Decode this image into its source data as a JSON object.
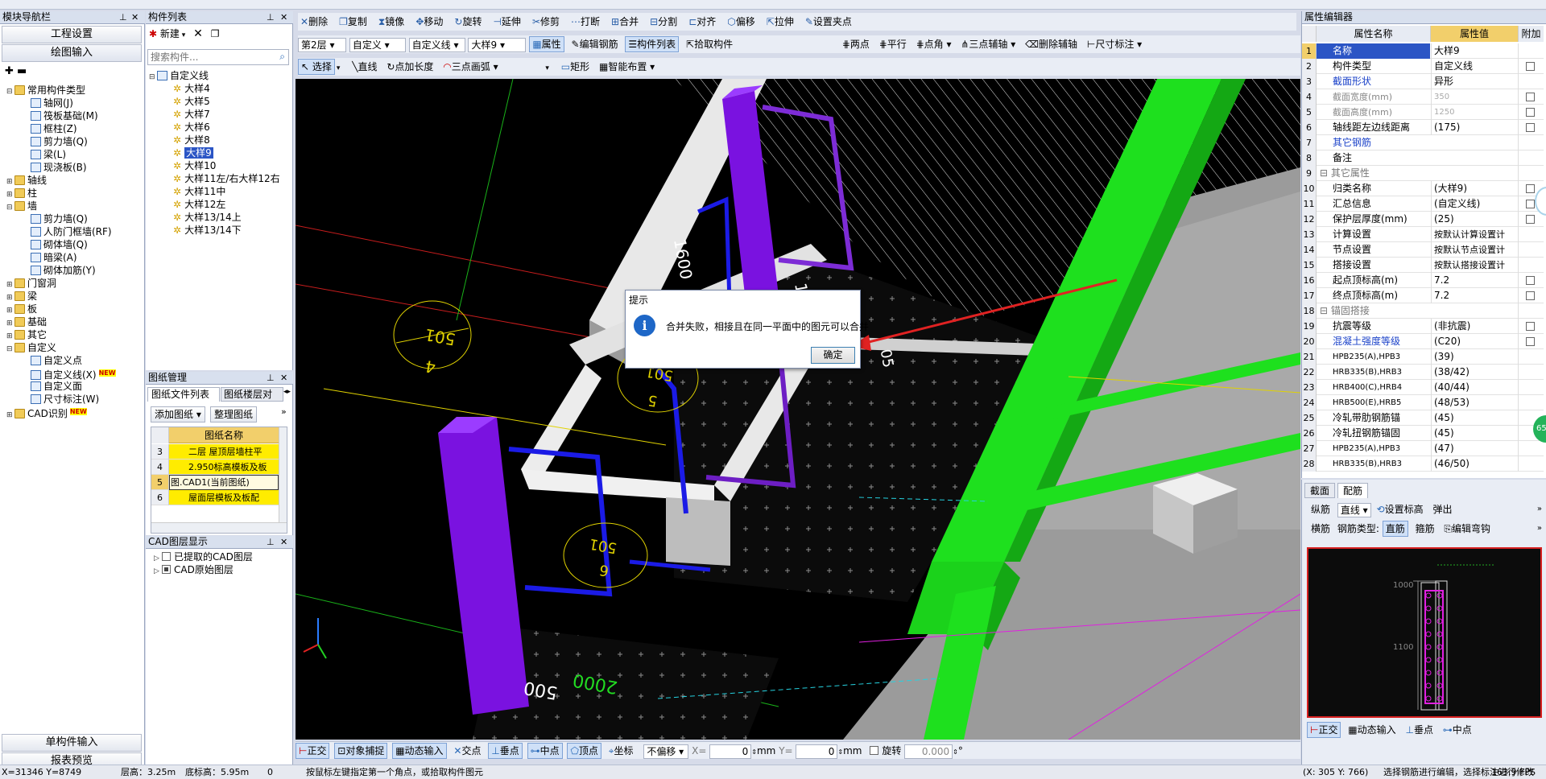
{
  "top_toolbar": [
    "删除",
    "复制",
    "镜像",
    "移动",
    "旋转",
    "延伸",
    "修剪",
    "打断",
    "合并",
    "分割",
    "对齐",
    "偏移",
    "拉伸",
    "设置夹点"
  ],
  "nav": {
    "title": "模块导航栏",
    "btn_project": "工程设置",
    "btn_draw": "绘图输入",
    "tree": [
      {
        "label": "常用构件类型",
        "lvl": 0,
        "type": "folder",
        "tog": "▬"
      },
      {
        "label": "轴网(J)",
        "lvl": 1
      },
      {
        "label": "筏板基础(M)",
        "lvl": 1
      },
      {
        "label": "框柱(Z)",
        "lvl": 1
      },
      {
        "label": "剪力墙(Q)",
        "lvl": 1
      },
      {
        "label": "梁(L)",
        "lvl": 1
      },
      {
        "label": "现浇板(B)",
        "lvl": 1
      },
      {
        "label": "轴线",
        "lvl": 0,
        "type": "folder",
        "tog": "+"
      },
      {
        "label": "柱",
        "lvl": 0,
        "type": "folder",
        "tog": "+"
      },
      {
        "label": "墙",
        "lvl": 0,
        "type": "folder",
        "tog": "▬"
      },
      {
        "label": "剪力墙(Q)",
        "lvl": 1
      },
      {
        "label": "人防门框墙(RF)",
        "lvl": 1
      },
      {
        "label": "砌体墙(Q)",
        "lvl": 1
      },
      {
        "label": "暗梁(A)",
        "lvl": 1
      },
      {
        "label": "砌体加筋(Y)",
        "lvl": 1
      },
      {
        "label": "门窗洞",
        "lvl": 0,
        "type": "folder",
        "tog": "+"
      },
      {
        "label": "梁",
        "lvl": 0,
        "type": "folder",
        "tog": "+"
      },
      {
        "label": "板",
        "lvl": 0,
        "type": "folder",
        "tog": "+"
      },
      {
        "label": "基础",
        "lvl": 0,
        "type": "folder",
        "tog": "+"
      },
      {
        "label": "其它",
        "lvl": 0,
        "type": "folder",
        "tog": "+"
      },
      {
        "label": "自定义",
        "lvl": 0,
        "type": "folder",
        "tog": "▬"
      },
      {
        "label": "自定义点",
        "lvl": 1
      },
      {
        "label": "自定义线(X)",
        "lvl": 1,
        "badge": "NEW"
      },
      {
        "label": "自定义面",
        "lvl": 1
      },
      {
        "label": "尺寸标注(W)",
        "lvl": 1
      },
      {
        "label": "CAD识别",
        "lvl": 0,
        "type": "folder",
        "tog": "+",
        "badge": "NEW"
      }
    ],
    "btn_single": "单构件输入",
    "btn_report": "报表预览"
  },
  "comp": {
    "title": "构件列表",
    "new_label": "新建",
    "search_placeholder": "搜索构件...",
    "root": "自定义线",
    "items": [
      "大样4",
      "大样5",
      "大样7",
      "大样6",
      "大样8",
      "大样9",
      "大样10",
      "大样11左/右大样12右",
      "大样11中",
      "大样12左",
      "大样13/14上",
      "大样13/14下"
    ],
    "selected_index": 5
  },
  "drawing": {
    "title": "图纸管理",
    "tab1": "图纸文件列表",
    "tab2": "图纸楼层对",
    "btn_add": "添加图纸",
    "btn_organize": "整理图纸",
    "col_header": "图纸名称",
    "rows": [
      {
        "n": "3",
        "name": "二层 屋顶层墙柱平"
      },
      {
        "n": "4",
        "name": "2.950标高模板及板"
      },
      {
        "n": "5",
        "name": "图.CAD1(当前图纸)"
      },
      {
        "n": "6",
        "name": "屋面层模板及板配"
      }
    ]
  },
  "cad_layers": {
    "title": "CAD图层显示",
    "items": [
      "已提取的CAD图层",
      "CAD原始图层"
    ]
  },
  "toolbar2": {
    "floor": "第2层",
    "type": "自定义",
    "subtype": "自定义线",
    "item": "大样9",
    "buttons": [
      "属性",
      "编辑钢筋",
      "构件列表",
      "拾取构件"
    ],
    "right_buttons": [
      "两点",
      "平行",
      "点角",
      "三点辅轴",
      "删除辅轴",
      "尺寸标注"
    ]
  },
  "toolbar3": {
    "buttons": [
      "选择",
      "直线",
      "点加长度",
      "三点画弧",
      "矩形",
      "智能布置"
    ]
  },
  "viewport": {
    "labels": [
      "1600",
      "1600",
      "501",
      "4",
      "501",
      "5",
      "501",
      "6",
      "500",
      "2000",
      "05"
    ]
  },
  "dialog": {
    "title": "提示",
    "message": "合并失败，相接且在同一平面中的图元可以合并",
    "ok_label": "确定"
  },
  "bottom_bar": {
    "buttons": [
      "正交",
      "对象捕捉",
      "动态输入",
      "交点",
      "垂点",
      "中点",
      "顶点",
      "坐标"
    ],
    "offset_select": "不偏移",
    "x_label": "X=",
    "x_value": "0",
    "y_label": "Y=",
    "y_value": "0",
    "unit": "mm",
    "rotate_label": "旋转",
    "rotate_value": "0.000",
    "deg": "°"
  },
  "props": {
    "title": "属性编辑器",
    "col_name": "属性名称",
    "col_value": "属性值",
    "col_extra": "附加",
    "rows": [
      {
        "n": "1",
        "k": "名称",
        "v": "大样9",
        "cb": false
      },
      {
        "n": "2",
        "k": "构件类型",
        "v": "自定义线",
        "cb": true
      },
      {
        "n": "3",
        "k": "截面形状",
        "v": "异形",
        "cb": false,
        "blue": true
      },
      {
        "n": "4",
        "k": "截面宽度(mm)",
        "v": "350",
        "cb": true,
        "gray": true
      },
      {
        "n": "5",
        "k": "截面高度(mm)",
        "v": "1250",
        "cb": true,
        "gray": true
      },
      {
        "n": "6",
        "k": "轴线距左边线距离",
        "v": "(175)",
        "cb": true
      },
      {
        "n": "7",
        "k": "其它钢筋",
        "v": "",
        "cb": false,
        "blue": true
      },
      {
        "n": "8",
        "k": "备注",
        "v": "",
        "cb": false
      },
      {
        "n": "9",
        "k": "其它属性",
        "v": "",
        "cb": false,
        "group": true
      },
      {
        "n": "10",
        "k": "归类名称",
        "v": "(大样9)",
        "cb": true
      },
      {
        "n": "11",
        "k": "汇总信息",
        "v": "(自定义线)",
        "cb": true
      },
      {
        "n": "12",
        "k": "保护层厚度(mm)",
        "v": "(25)",
        "cb": true
      },
      {
        "n": "13",
        "k": "计算设置",
        "v": "按默认计算设置计",
        "cb": false
      },
      {
        "n": "14",
        "k": "节点设置",
        "v": "按默认节点设置计",
        "cb": false
      },
      {
        "n": "15",
        "k": "搭接设置",
        "v": "按默认搭接设置计",
        "cb": false
      },
      {
        "n": "16",
        "k": "起点顶标高(m)",
        "v": "7.2",
        "cb": true
      },
      {
        "n": "17",
        "k": "终点顶标高(m)",
        "v": "7.2",
        "cb": true
      },
      {
        "n": "18",
        "k": "锚固搭接",
        "v": "",
        "cb": false,
        "group": true
      },
      {
        "n": "19",
        "k": "抗震等级",
        "v": "(非抗震)",
        "cb": true
      },
      {
        "n": "20",
        "k": "混凝土强度等级",
        "v": "(C20)",
        "cb": true,
        "blue": true
      },
      {
        "n": "21",
        "k": "HPB235(A),HPB3",
        "v": "(39)",
        "cb": false
      },
      {
        "n": "22",
        "k": "HRB335(B),HRB3",
        "v": "(38/42)",
        "cb": false
      },
      {
        "n": "23",
        "k": "HRB400(C),HRB4",
        "v": "(40/44)",
        "cb": false
      },
      {
        "n": "24",
        "k": "HRB500(E),HRB5",
        "v": "(48/53)",
        "cb": false
      },
      {
        "n": "25",
        "k": "冷轧带肋钢筋锚",
        "v": "(45)",
        "cb": false
      },
      {
        "n": "26",
        "k": "冷轧扭钢筋锚固",
        "v": "(45)",
        "cb": false
      },
      {
        "n": "27",
        "k": "HPB235(A),HPB3",
        "v": "(47)",
        "cb": false
      },
      {
        "n": "28",
        "k": "HRB335(B),HRB3",
        "v": "(46/50)",
        "cb": false
      }
    ]
  },
  "rebar": {
    "tab_section": "截面",
    "tab_rebar": "配筋",
    "row1": [
      "纵筋",
      "直线",
      "设置标高",
      "弹出"
    ],
    "row2": [
      "横筋",
      "钢筋类型:",
      "直筋",
      "箍筋",
      "编辑弯钩"
    ],
    "preview_labels": [
      "1000",
      "1100"
    ],
    "bottom": [
      "正交",
      "动态输入",
      "垂点",
      "中点"
    ]
  },
  "status": {
    "coords": "X=31346 Y=8749",
    "floor_height": "层高：3.25m",
    "bottom_height": "底标高：5.95m",
    "zero": "0",
    "prompt": "按鼠标左键指定第一个角点，或拾取构件图元",
    "right_coords": "(X: 305 Y: 766)",
    "right_prompt": "选择钢筋进行编辑，选择标注进行修改",
    "fps": "163.9 FPS"
  },
  "side_badge": "65"
}
